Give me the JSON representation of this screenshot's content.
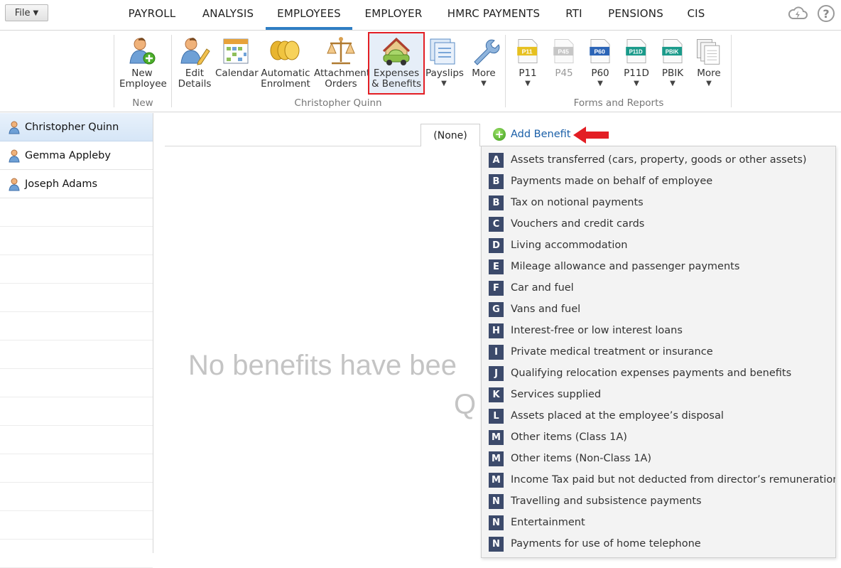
{
  "menubar": {
    "file_label": "File",
    "tabs": [
      "PAYROLL",
      "ANALYSIS",
      "EMPLOYEES",
      "EMPLOYER",
      "HMRC PAYMENTS",
      "RTI",
      "PENSIONS",
      "CIS"
    ],
    "active_tab": "EMPLOYEES",
    "help_label": "?"
  },
  "ribbon": {
    "groups": {
      "new": "New",
      "employee": "Christopher Quinn",
      "forms": "Forms and Reports"
    },
    "buttons": {
      "new_employee": "New\nEmployee",
      "edit_details": "Edit\nDetails",
      "calendar": "Calendar",
      "automatic_enrolment": "Automatic\nEnrolment",
      "attachment_orders": "Attachment\nOrders",
      "expenses_benefits": "Expenses\n& Benefits",
      "payslips": "Payslips",
      "more_employee": "More",
      "p11": "P11",
      "p45": "P45",
      "p60": "P60",
      "p11d": "P11D",
      "pbik": "PBIK",
      "more_forms": "More"
    },
    "form_badges": {
      "p11": "P11",
      "p45": "P45",
      "p60": "P60",
      "p11d": "P11D",
      "pbik": "PBIK"
    },
    "dropdown_glyph": "▼"
  },
  "sidebar": {
    "employees": [
      "Christopher Quinn",
      "Gemma Appleby",
      "Joseph Adams"
    ],
    "selected": "Christopher Quinn"
  },
  "main": {
    "tab_label": "(None)",
    "add_benefit_label": "Add Benefit",
    "empty_message_line1": "No benefits have bee",
    "empty_message_line2": "Q"
  },
  "benefit_menu": [
    {
      "code": "A",
      "label": "Assets transferred (cars, property, goods or other assets)"
    },
    {
      "code": "B",
      "label": "Payments made on behalf of employee"
    },
    {
      "code": "B",
      "label": "Tax on notional payments"
    },
    {
      "code": "C",
      "label": "Vouchers and credit cards"
    },
    {
      "code": "D",
      "label": "Living accommodation"
    },
    {
      "code": "E",
      "label": "Mileage allowance and passenger payments"
    },
    {
      "code": "F",
      "label": "Car and fuel"
    },
    {
      "code": "G",
      "label": "Vans and fuel"
    },
    {
      "code": "H",
      "label": "Interest-free or low interest loans"
    },
    {
      "code": "I",
      "label": "Private medical treatment or insurance"
    },
    {
      "code": "J",
      "label": "Qualifying relocation expenses payments and benefits"
    },
    {
      "code": "K",
      "label": "Services supplied"
    },
    {
      "code": "L",
      "label": "Assets placed at the employee’s disposal"
    },
    {
      "code": "M",
      "label": "Other items (Class 1A)"
    },
    {
      "code": "M",
      "label": "Other items (Non-Class 1A)"
    },
    {
      "code": "M",
      "label": "Income Tax paid but not deducted from director’s remuneration"
    },
    {
      "code": "N",
      "label": "Travelling and subsistence payments"
    },
    {
      "code": "N",
      "label": "Entertainment"
    },
    {
      "code": "N",
      "label": "Payments for use of home telephone"
    }
  ],
  "colors": {
    "accent": "#2f7ec4",
    "highlight_box": "#e31e24",
    "code_badge": "#3c4a6b",
    "link": "#1a5fa8"
  }
}
